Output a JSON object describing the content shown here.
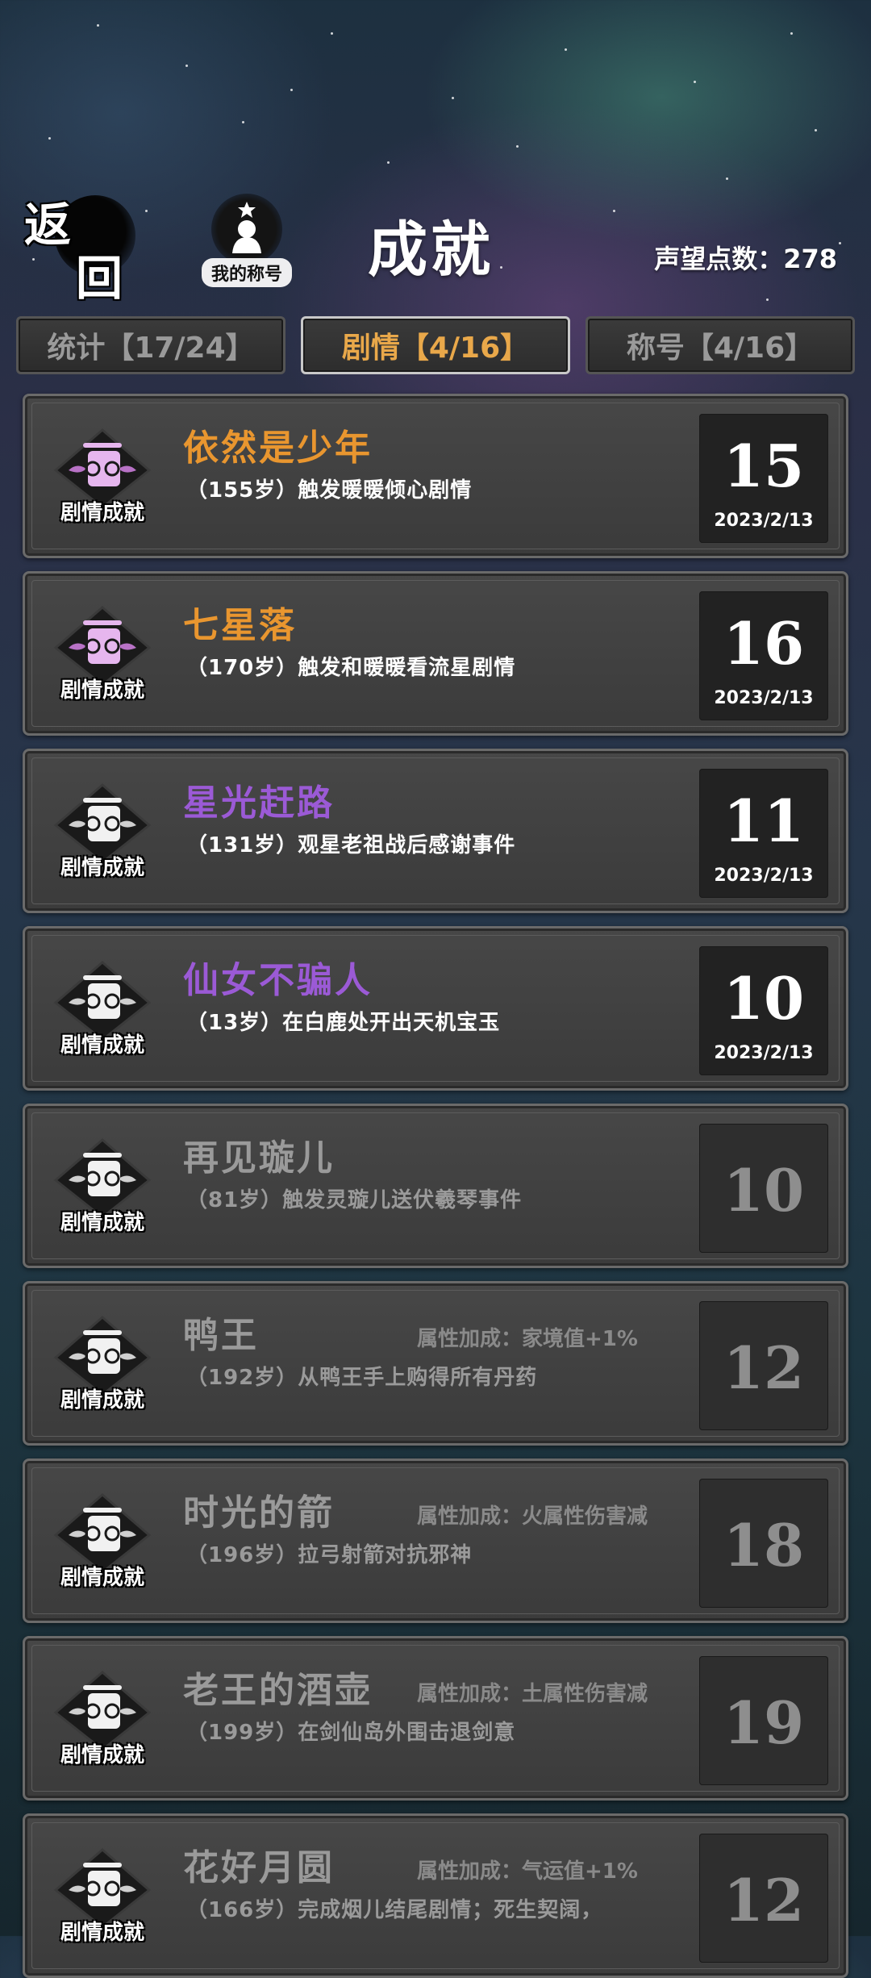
{
  "header": {
    "back_label_1": "返",
    "back_label_2": "回",
    "my_title_label": "我的称号",
    "page_title": "成就",
    "prestige_label": "声望点数：278"
  },
  "tabs": [
    {
      "label": "统计【17/24】",
      "active": false
    },
    {
      "label": "剧情【4/16】",
      "active": true
    },
    {
      "label": "称号【4/16】",
      "active": false
    }
  ],
  "badge_label": "剧情成就",
  "achievements": [
    {
      "title": "依然是少年",
      "title_color": "#e9962f",
      "badge": "pink",
      "desc": "（155岁）触发暖暖倾心剧情",
      "attr": "",
      "points": "15",
      "date": "2023/2/13",
      "unlocked": true
    },
    {
      "title": "七星落",
      "title_color": "#e9962f",
      "badge": "pink",
      "desc": "（170岁）触发和暖暖看流星剧情",
      "attr": "",
      "points": "16",
      "date": "2023/2/13",
      "unlocked": true
    },
    {
      "title": "星光赶路",
      "title_color": "#9b5ad6",
      "badge": "white",
      "desc": "（131岁）观星老祖战后感谢事件",
      "attr": "",
      "points": "11",
      "date": "2023/2/13",
      "unlocked": true
    },
    {
      "title": "仙女不骗人",
      "title_color": "#9b5ad6",
      "badge": "white",
      "desc": "（13岁）在白鹿处开出天机宝玉",
      "attr": "",
      "points": "10",
      "date": "2023/2/13",
      "unlocked": true
    },
    {
      "title": "再见璇儿",
      "title_color": "#9a9a9a",
      "badge": "white",
      "desc": "（81岁）触发灵璇儿送伏羲琴事件",
      "attr": "",
      "points": "10",
      "date": "",
      "unlocked": false
    },
    {
      "title": "鸭王",
      "title_color": "#9a9a9a",
      "badge": "white",
      "desc": "（192岁）从鸭王手上购得所有丹药",
      "attr": "属性加成：家境值+1%",
      "points": "12",
      "date": "",
      "unlocked": false
    },
    {
      "title": "时光的箭",
      "title_color": "#9a9a9a",
      "badge": "white",
      "desc": "（196岁）拉弓射箭对抗邪神",
      "attr": "属性加成：火属性伤害减",
      "points": "18",
      "date": "",
      "unlocked": false
    },
    {
      "title": "老王的酒壶",
      "title_color": "#9a9a9a",
      "badge": "white",
      "desc": "（199岁）在剑仙岛外围击退剑意",
      "attr": "属性加成：土属性伤害减",
      "points": "19",
      "date": "",
      "unlocked": false
    },
    {
      "title": "花好月圆",
      "title_color": "#9a9a9a",
      "badge": "white",
      "desc": "（166岁）完成烟儿结尾剧情；死生契阔，",
      "attr": "属性加成：气运值+1%",
      "points": "12",
      "date": "",
      "unlocked": false
    }
  ]
}
